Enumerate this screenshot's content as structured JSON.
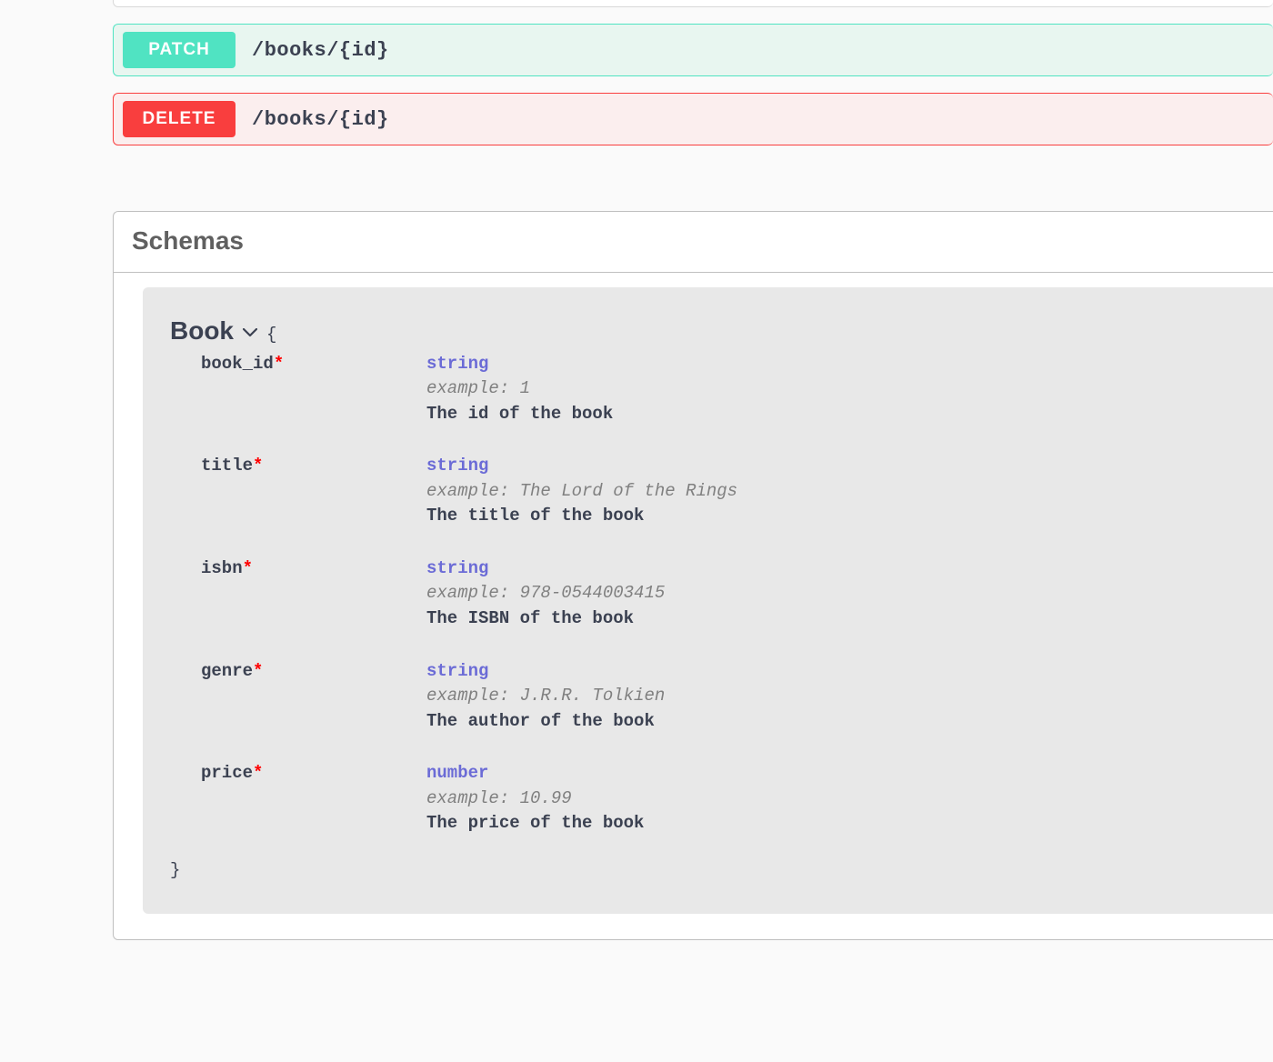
{
  "endpoints": [
    {
      "method": "PATCH",
      "path": "/books/{id}"
    },
    {
      "method": "DELETE",
      "path": "/books/{id}"
    }
  ],
  "schemas_section": {
    "title": "Schemas",
    "schema": {
      "name": "Book",
      "open_brace": "{",
      "close_brace": "}",
      "properties": [
        {
          "name": "book_id",
          "required": true,
          "type": "string",
          "example": "example: 1",
          "description": "The id of the book"
        },
        {
          "name": "title",
          "required": true,
          "type": "string",
          "example": "example: The Lord of the Rings",
          "description": "The title of the book"
        },
        {
          "name": "isbn",
          "required": true,
          "type": "string",
          "example": "example: 978-0544003415",
          "description": "The ISBN of the book"
        },
        {
          "name": "genre",
          "required": true,
          "type": "string",
          "example": "example: J.R.R. Tolkien",
          "description": "The author of the book"
        },
        {
          "name": "price",
          "required": true,
          "type": "number",
          "example": "example: 10.99",
          "description": "The price of the book"
        }
      ]
    }
  },
  "symbols": {
    "star": "*"
  }
}
